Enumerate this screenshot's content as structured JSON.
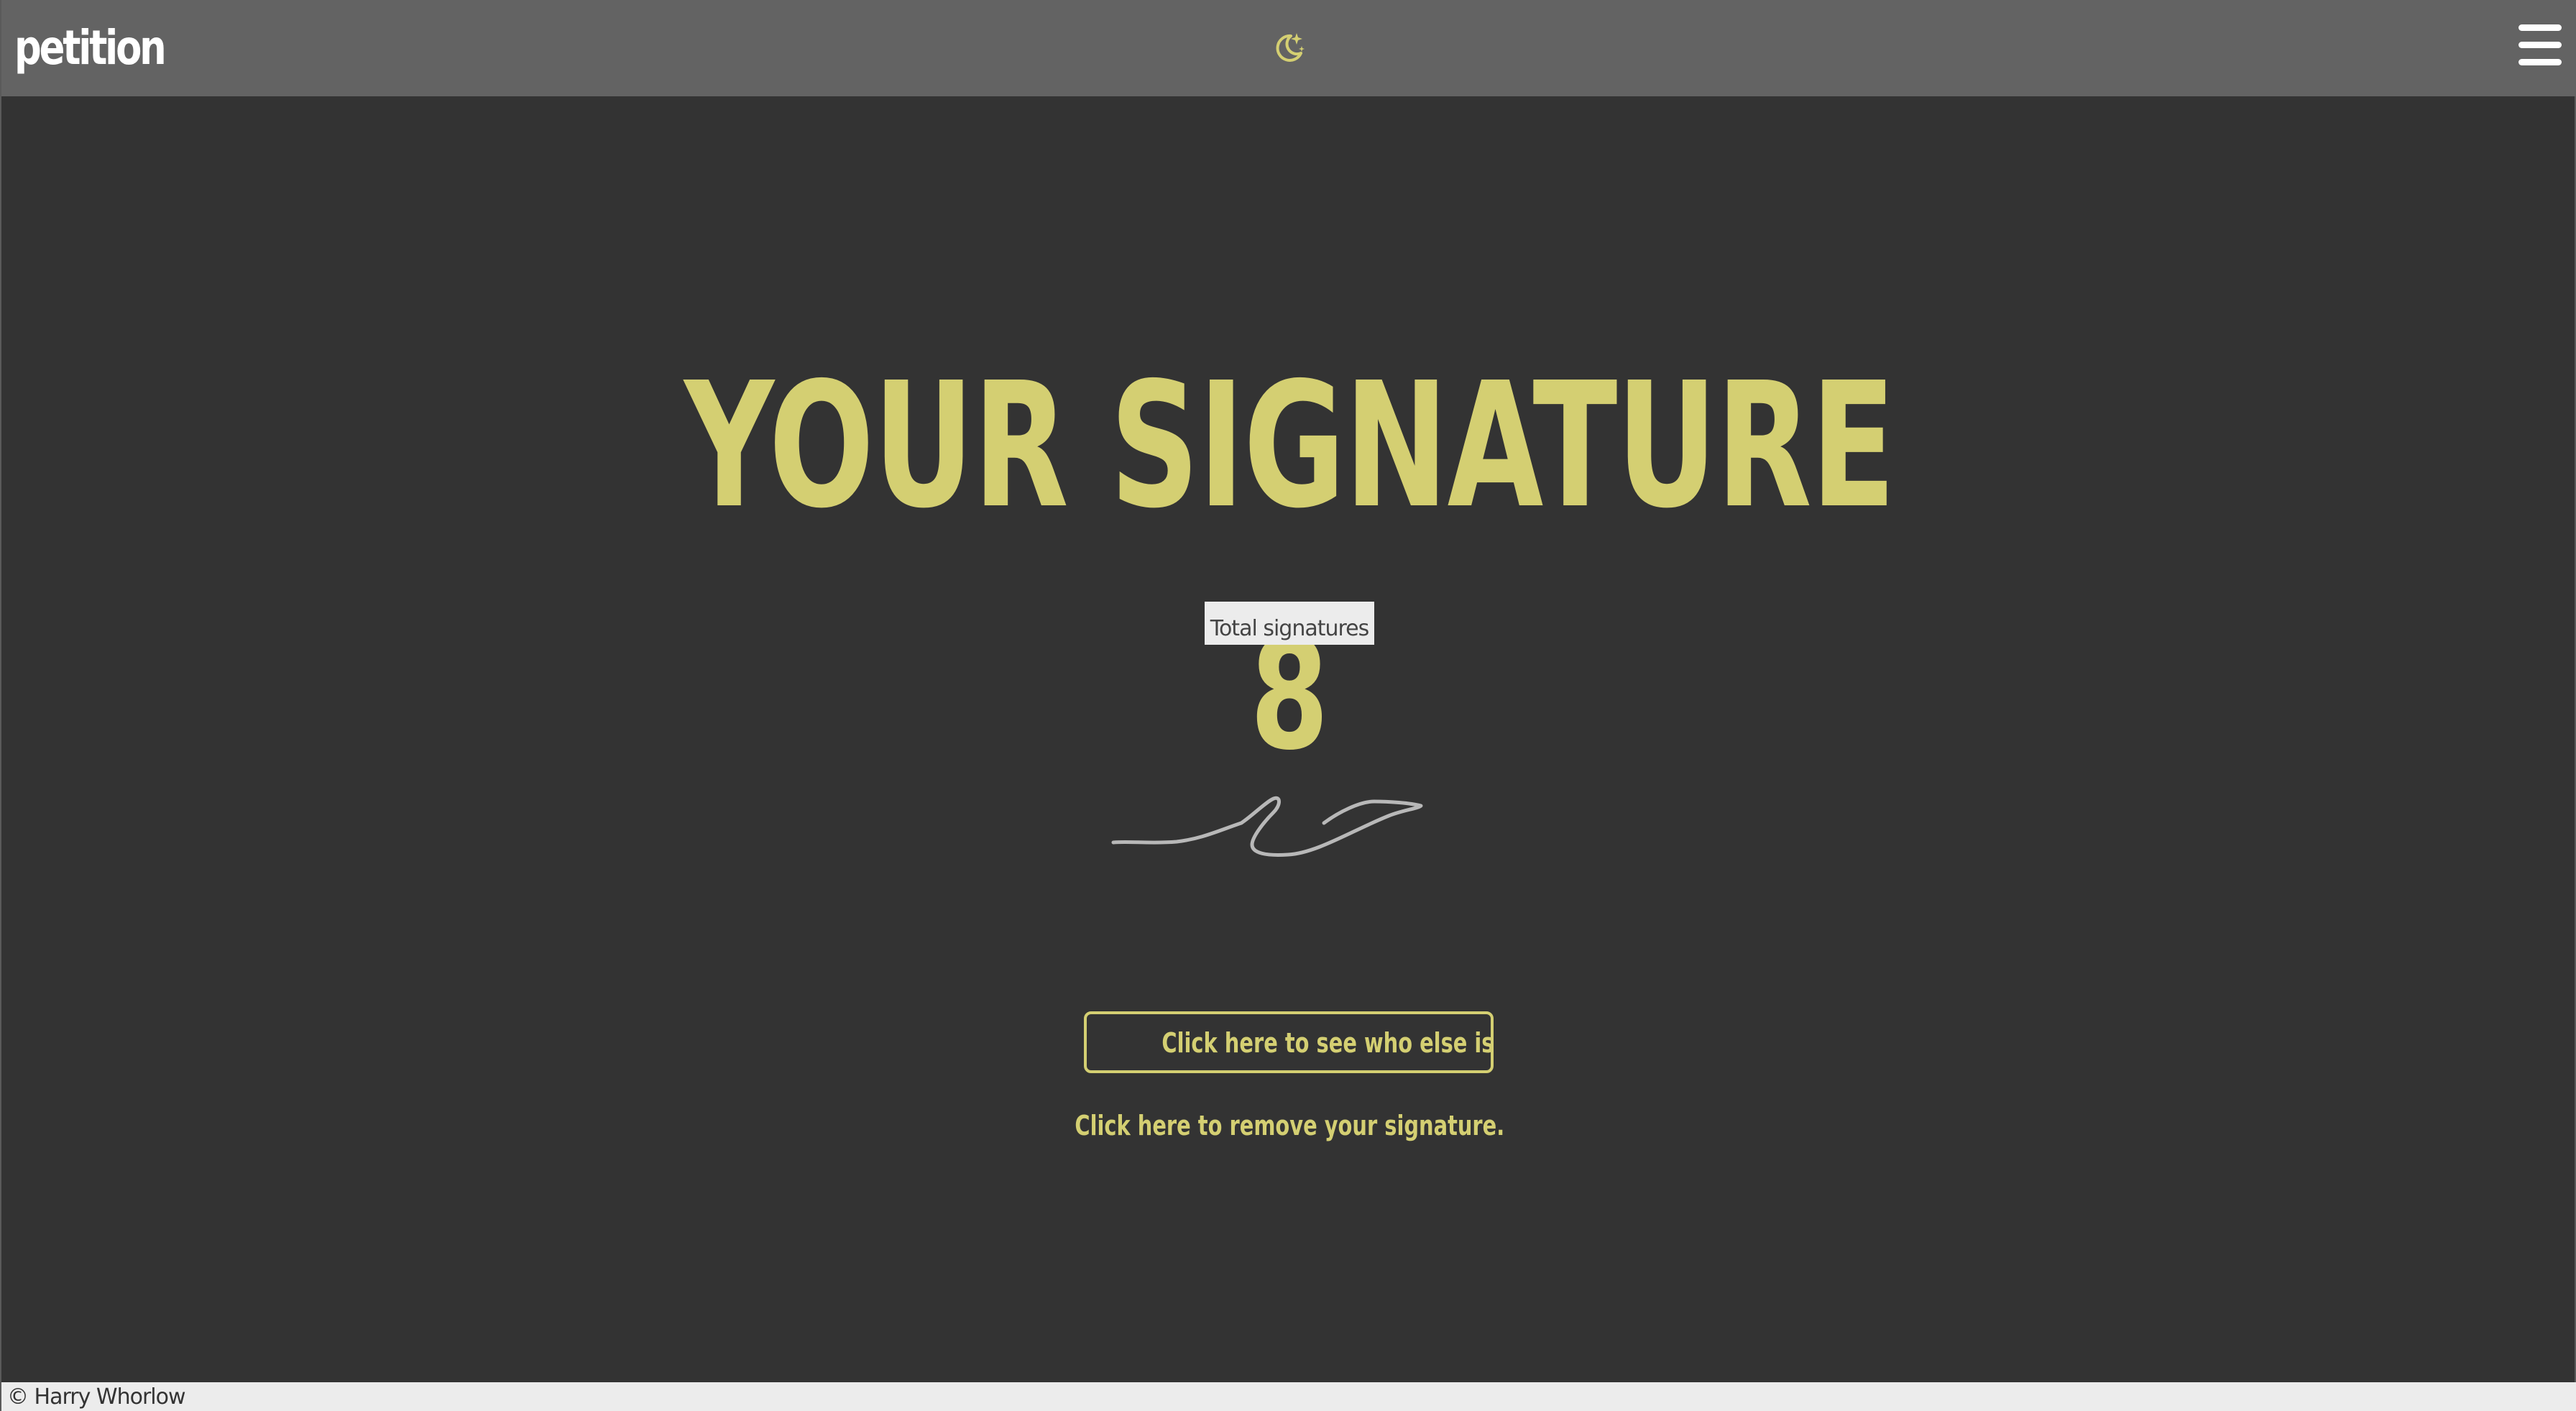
{
  "header": {
    "brand": "petition",
    "theme_toggle_icon": "moon-stars-icon",
    "menu_icon": "hamburger-menu-icon"
  },
  "main": {
    "headline": "YOUR SIGNATURE",
    "signature_count": "8",
    "tooltip": "Total signatures",
    "signature_image": "handwritten-signature",
    "cta_label": "Click here to see who else is involved!",
    "remove_label": "Click here to remove your signature."
  },
  "footer": {
    "copyright": "© Harry Whorlow"
  },
  "colors": {
    "accent": "#d4cf72",
    "background": "#333333",
    "topbar": "#636363",
    "footer": "#ececec"
  }
}
